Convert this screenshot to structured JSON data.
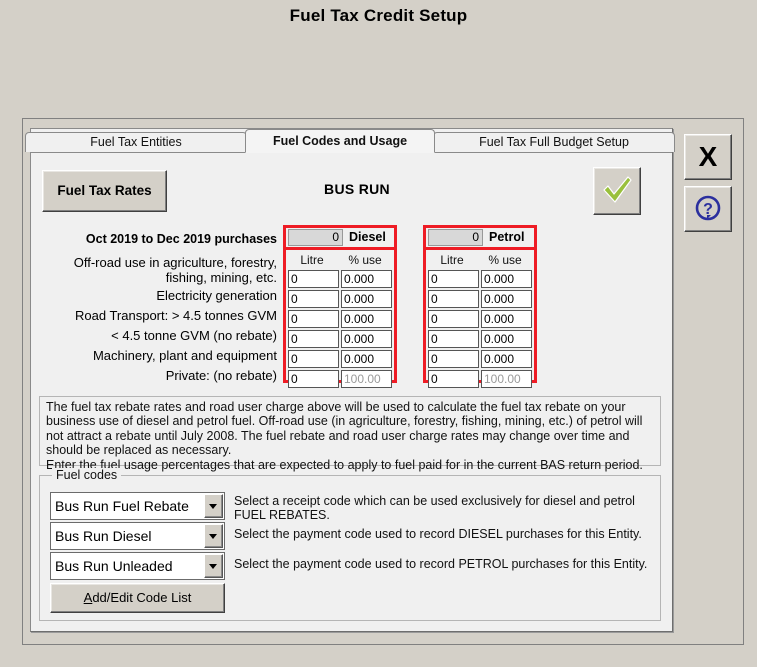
{
  "window": {
    "title": "Fuel Tax Credit Setup"
  },
  "tabs": [
    {
      "label": "Fuel Tax Entities",
      "active": false
    },
    {
      "label": "Fuel Codes and Usage",
      "active": true
    },
    {
      "label": "Fuel Tax Full Budget Setup",
      "active": false
    }
  ],
  "toolbar": {
    "fuel_tax_rates_label": "Fuel Tax Rates",
    "entity_name": "BUS RUN",
    "confirm_icon": "green-check-icon",
    "close_label": "X",
    "help_icon": "question-mark-icon"
  },
  "grid": {
    "period_label": "Oct 2019 to Dec 2019 purchases",
    "column_headers": [
      "Litre",
      "% use"
    ],
    "row_labels": [
      "Off-road use in agriculture, forestry, fishing, mining, etc.",
      "Electricity generation",
      "Road Transport: > 4.5 tonnes GVM",
      "< 4.5 tonne GVM (no rebate)",
      "Machinery, plant and equipment",
      "Private: (no rebate)"
    ],
    "fuels": [
      {
        "name": "Diesel",
        "total": "0",
        "rows": [
          {
            "litre": "0",
            "pct": "0.000",
            "disabled": false
          },
          {
            "litre": "0",
            "pct": "0.000",
            "disabled": false
          },
          {
            "litre": "0",
            "pct": "0.000",
            "disabled": false
          },
          {
            "litre": "0",
            "pct": "0.000",
            "disabled": false
          },
          {
            "litre": "0",
            "pct": "0.000",
            "disabled": false
          },
          {
            "litre": "0",
            "pct": "100.00",
            "disabled": true
          }
        ]
      },
      {
        "name": "Petrol",
        "total": "0",
        "rows": [
          {
            "litre": "0",
            "pct": "0.000",
            "disabled": false
          },
          {
            "litre": "0",
            "pct": "0.000",
            "disabled": false
          },
          {
            "litre": "0",
            "pct": "0.000",
            "disabled": false
          },
          {
            "litre": "0",
            "pct": "0.000",
            "disabled": false
          },
          {
            "litre": "0",
            "pct": "0.000",
            "disabled": false
          },
          {
            "litre": "0",
            "pct": "100.00",
            "disabled": true
          }
        ]
      }
    ],
    "highlight_color": "#ee1c25"
  },
  "note": {
    "paragraph": "The fuel tax rebate rates and road user charge above will be used to calculate the fuel tax rebate on your business use of diesel and petrol fuel. Off-road use (in agriculture, forestry, fishing, mining, etc.) of petrol will not attract a rebate until July 2008. The fuel rebate and road user charge rates may change over time and should be replaced as necessary.",
    "line2": "Enter the fuel usage percentages that are expected to apply to fuel paid for in the current BAS return period."
  },
  "fuel_codes": {
    "legend": "Fuel codes",
    "entries": [
      {
        "value": "Bus Run Fuel Rebate",
        "description": "Select a receipt code which can be used exclusively for diesel and petrol FUEL REBATES."
      },
      {
        "value": "Bus Run Diesel",
        "description": "Select the payment code used to record DIESEL purchases for this Entity."
      },
      {
        "value": "Bus Run Unleaded",
        "description": "Select the payment code used to record PETROL purchases for this Entity."
      }
    ],
    "add_edit_button": "Add/Edit Code List",
    "add_edit_accelerator": "A"
  },
  "colors": {
    "window_background": "#d4d0c8",
    "panel_background": "#f0f0f0",
    "highlight": "#ee1c25",
    "check_green": "#9ac03c",
    "help_blue": "#2b2f9e"
  }
}
